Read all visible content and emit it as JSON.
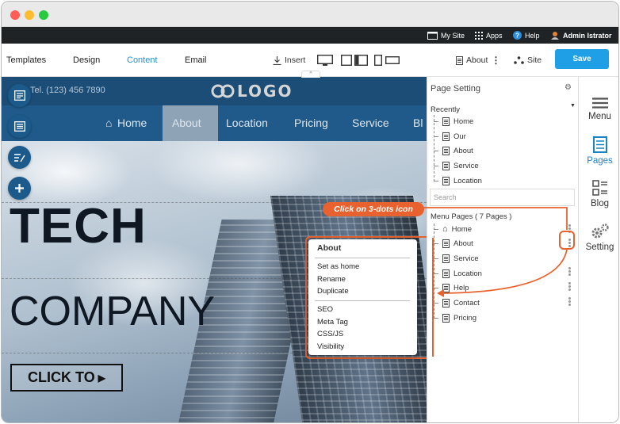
{
  "topbar": {
    "my_site": "My Site",
    "apps": "Apps",
    "help": "Help",
    "admin": "Admin Istrator"
  },
  "toolbar": {
    "tabs": [
      "Templates",
      "Design",
      "Content",
      "Email"
    ],
    "active_tab": "Content",
    "insert": "Insert",
    "page_selector": "About",
    "site": "Site",
    "save": "Save"
  },
  "site": {
    "phone": "Tel. (123) 456 7890",
    "logo": "LOGO",
    "nav": [
      "Home",
      "About",
      "Location",
      "Pricing",
      "Service",
      "Bl"
    ],
    "nav_active": "About",
    "hero_title": "TECH",
    "hero_subtitle": "COMPANY",
    "hero_button": "CLICK TO"
  },
  "context_menu": {
    "header": "About",
    "group1": [
      "Set as home",
      "Rename",
      "Duplicate"
    ],
    "group2": [
      "SEO",
      "Meta Tag",
      "CSS/JS",
      "Visibility"
    ]
  },
  "panel": {
    "title": "Page Setting",
    "recently_label": "Recently",
    "recent_pages": [
      "Home",
      "Our",
      "About",
      "Service",
      "Location"
    ],
    "search_placeholder": "Search",
    "menu_pages_label": "Menu Pages ( 7 Pages )",
    "menu_pages": [
      "Home",
      "About",
      "Service",
      "Location",
      "Help",
      "Contact",
      "Pricing"
    ]
  },
  "callout": "Click on 3-dots icon",
  "rail": {
    "items": [
      "Menu",
      "Pages",
      "Blog",
      "Setting"
    ],
    "active": "Pages"
  },
  "colors": {
    "accent": "#1fa0e6",
    "callout": "#e8622f",
    "site_nav": "#1f5a8a"
  }
}
